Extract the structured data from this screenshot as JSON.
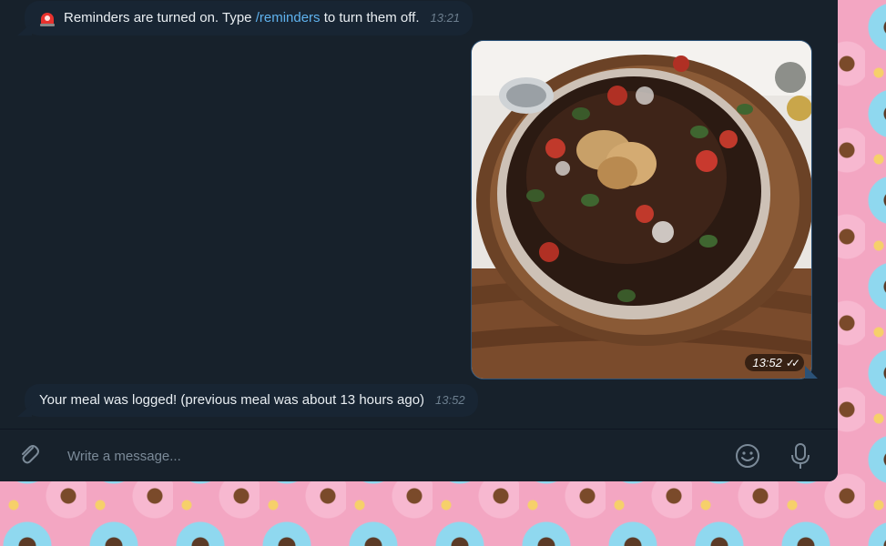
{
  "messages": {
    "reminder": {
      "text_prefix": "Reminders are turned on. Type ",
      "command": "/reminders",
      "text_suffix": " to turn them off.",
      "time": "13:21",
      "icon": "rotating-light-emoji"
    },
    "photo": {
      "time": "13:52",
      "status": "read",
      "ticks": "✓✓"
    },
    "logged": {
      "text": "Your meal was logged! (previous meal was about 13 hours ago)",
      "time": "13:52"
    }
  },
  "composer": {
    "placeholder": "Write a message...",
    "attach_icon": "paperclip-icon",
    "emoji_icon": "smiley-icon",
    "mic_icon": "microphone-icon"
  },
  "colors": {
    "chat_bg": "#17212b",
    "incoming_bubble": "#182533",
    "outgoing_accent": "#2b5278",
    "link": "#5fb2ee"
  }
}
